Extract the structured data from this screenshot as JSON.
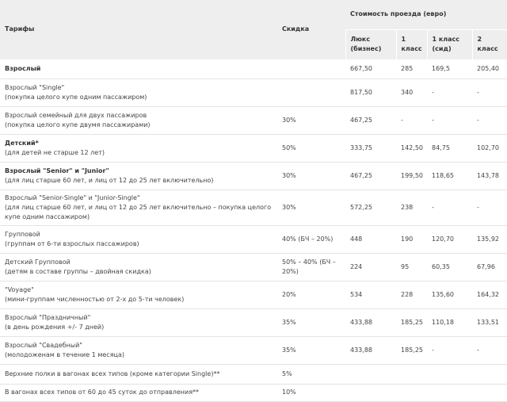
{
  "headers": {
    "tariffs": "Тарифы",
    "discount": "Скидка",
    "fare_cost": "Стоимость проезда (евро)",
    "classes": [
      {
        "line1": "Люкс",
        "line2": "(бизнес)"
      },
      {
        "line1": "1",
        "line2": "класс"
      },
      {
        "line1": "1 класс",
        "line2": "(сид)"
      },
      {
        "line1": "2",
        "line2": "класс"
      }
    ]
  },
  "rows": [
    {
      "title": "Взрослый",
      "note": "",
      "bold": true,
      "discount": "",
      "lux": "667,50",
      "c1": "285",
      "c1sid": "169,5",
      "c2": "205,40"
    },
    {
      "title": "Взрослый \"Single\"",
      "note": "(покупка целого купе одним пассажиром)",
      "bold": false,
      "discount": "",
      "lux": "817,50",
      "c1": "340",
      "c1sid": "-",
      "c2": "-"
    },
    {
      "title": "Взрослый семейный для двух пассажиров",
      "note": "(покупка целого купе двумя пассажирами)",
      "bold": false,
      "discount": "30%",
      "lux": "467,25",
      "c1": "-",
      "c1sid": "-",
      "c2": "-"
    },
    {
      "title": "Детский*",
      "note": "(для детей не старше 12 лет)",
      "bold": true,
      "discount": "50%",
      "lux": "333,75",
      "c1": "142,50",
      "c1sid": "84,75",
      "c2": "102,70"
    },
    {
      "title": "Взрослый \"Senior\" и \"Junior\"",
      "note": "(для лиц старше 60 лет, и лиц от 12 до 25 лет включительно)",
      "bold": true,
      "discount": "30%",
      "lux": "467,25",
      "c1": "199,50",
      "c1sid": "118,65",
      "c2": "143,78"
    },
    {
      "title": "Взрослый \"Senior-Single\" и \"Junior-Single\"",
      "note": "(для лиц старше 60 лет, и лиц от 12 до 25 лет включительно – покупка целого купе одним пассажиром)",
      "bold": false,
      "discount": "30%",
      "lux": "572,25",
      "c1": "238",
      "c1sid": "-",
      "c2": "-"
    },
    {
      "title": "Групповой",
      "note": "(группам от 6-ти взрослых пассажиров)",
      "bold": false,
      "discount": "40% (БЧ – 20%)",
      "lux": "448",
      "c1": "190",
      "c1sid": "120,70",
      "c2": "135,92"
    },
    {
      "title": "Детский Групповой",
      "note": "(детям в составе группы – двойная скидка)",
      "bold": false,
      "discount": "50% – 40% (БЧ – 20%)",
      "lux": "224",
      "c1": "95",
      "c1sid": "60,35",
      "c2": "67,96"
    },
    {
      "title": "\"Voyage\"",
      "note": "(мини-группам численностью от 2-х до 5-ти человек)",
      "bold": false,
      "discount": "20%",
      "lux": "534",
      "c1": "228",
      "c1sid": "135,60",
      "c2": "164,32"
    },
    {
      "title": "Взрослый \"Праздничный\"",
      "note": "(в день рождения +/- 7 дней)",
      "bold": false,
      "discount": "35%",
      "lux": "433,88",
      "c1": "185,25",
      "c1sid": "110,18",
      "c2": "133,51"
    },
    {
      "title": "Взрослый \"Свадебный\"",
      "note": "(молодоженам в течение 1 месяца)",
      "bold": false,
      "discount": "35%",
      "lux": "433,88",
      "c1": "185,25",
      "c1sid": "-",
      "c2": "-"
    },
    {
      "title": "Верхние полки в вагонах всех типов (кроме категории Single)**",
      "note": "",
      "bold": false,
      "discount": "5%",
      "lux": "",
      "c1": "",
      "c1sid": "",
      "c2": ""
    },
    {
      "title": "В вагонах всех типов от 60 до 45 суток до отправления**",
      "note": "",
      "bold": false,
      "discount": "10%",
      "lux": "",
      "c1": "",
      "c1sid": "",
      "c2": ""
    }
  ]
}
